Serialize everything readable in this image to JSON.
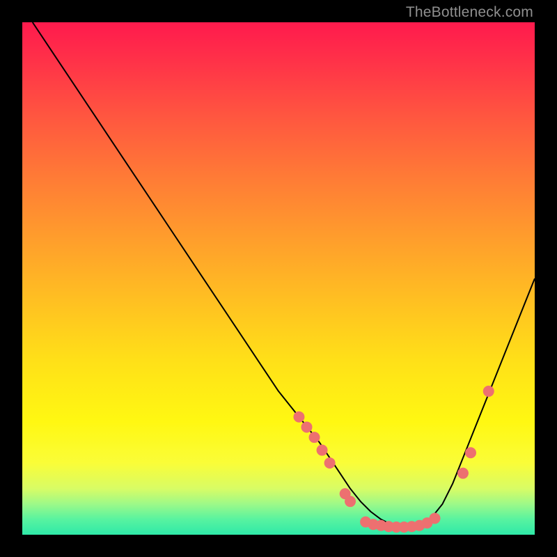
{
  "watermark": "TheBottleneck.com",
  "chart_data": {
    "type": "line",
    "title": "",
    "xlabel": "",
    "ylabel": "",
    "xlim": [
      0,
      100
    ],
    "ylim": [
      0,
      100
    ],
    "series": [
      {
        "name": "curve",
        "x": [
          2,
          6,
          10,
          14,
          18,
          22,
          26,
          30,
          34,
          38,
          42,
          46,
          50,
          54,
          58,
          62,
          64,
          66,
          68,
          70,
          72,
          74,
          76,
          78,
          80,
          82,
          84,
          86,
          88,
          92,
          96,
          100
        ],
        "y": [
          100,
          94,
          88,
          82,
          76,
          70,
          64,
          58,
          52,
          46,
          40,
          34,
          28,
          23,
          18,
          12,
          9,
          6.5,
          4.5,
          3,
          2,
          1.5,
          1.5,
          2,
          3.5,
          6,
          10,
          15,
          20,
          30,
          40,
          50
        ]
      }
    ],
    "markers": [
      {
        "x": 54,
        "y": 23
      },
      {
        "x": 55.5,
        "y": 21
      },
      {
        "x": 57,
        "y": 19
      },
      {
        "x": 58.5,
        "y": 16.5
      },
      {
        "x": 60,
        "y": 14
      },
      {
        "x": 63,
        "y": 8
      },
      {
        "x": 64,
        "y": 6.5
      },
      {
        "x": 67,
        "y": 2.5
      },
      {
        "x": 68.5,
        "y": 2
      },
      {
        "x": 70,
        "y": 1.8
      },
      {
        "x": 71.5,
        "y": 1.6
      },
      {
        "x": 73,
        "y": 1.5
      },
      {
        "x": 74.5,
        "y": 1.5
      },
      {
        "x": 76,
        "y": 1.6
      },
      {
        "x": 77.5,
        "y": 1.8
      },
      {
        "x": 79,
        "y": 2.3
      },
      {
        "x": 80.5,
        "y": 3.2
      },
      {
        "x": 86,
        "y": 12
      },
      {
        "x": 87.5,
        "y": 16
      },
      {
        "x": 91,
        "y": 28
      }
    ],
    "marker_color": "#ed7070",
    "marker_radius": 8,
    "curve_color": "#000000",
    "curve_width": 2
  }
}
